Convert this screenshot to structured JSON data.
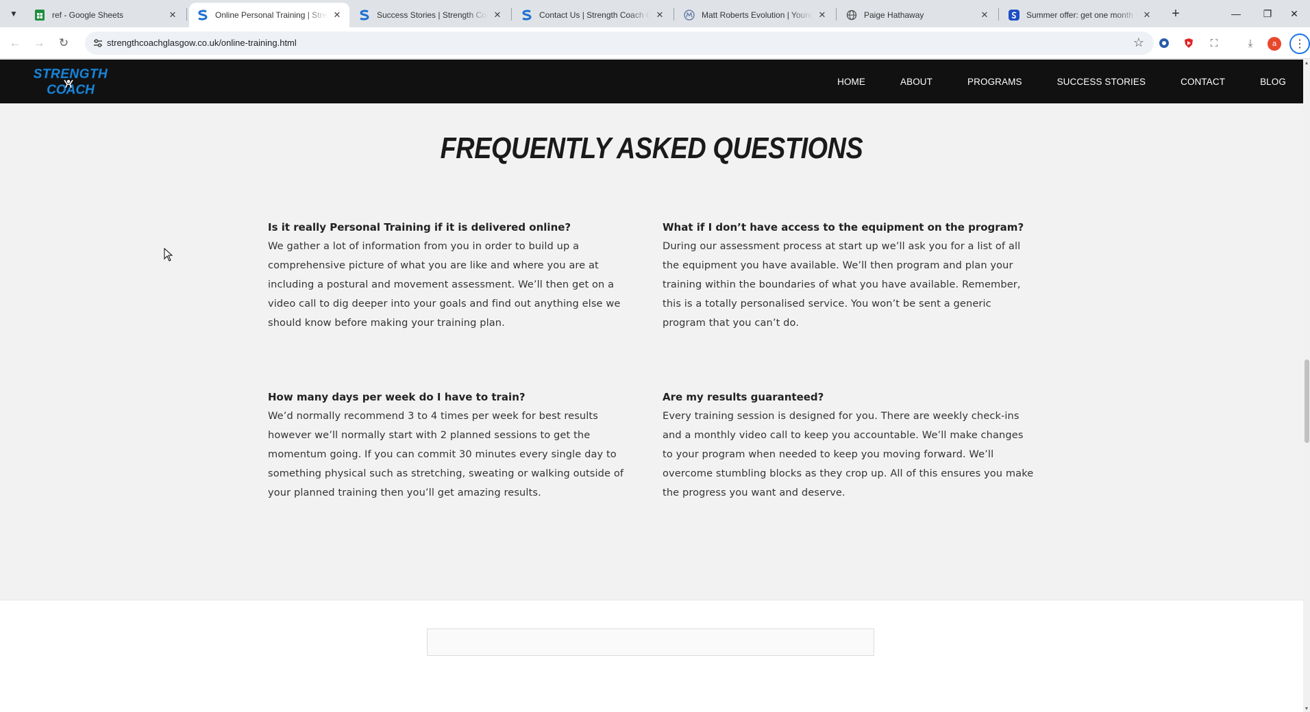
{
  "browser": {
    "tabs": [
      {
        "title": "ref - Google Sheets",
        "favicon": "sheets-icon",
        "active": false
      },
      {
        "title": "Online Personal Training | Strength Coach Glasgow",
        "favicon": "strength-coach-icon",
        "active": true
      },
      {
        "title": "Success Stories | Strength Coach Glasgow",
        "favicon": "strength-coach-icon",
        "active": false
      },
      {
        "title": "Contact Us | Strength Coach Glasgow",
        "favicon": "strength-coach-icon",
        "active": false
      },
      {
        "title": "Matt Roberts Evolution | Young",
        "favicon": "mr-icon",
        "active": false
      },
      {
        "title": "Paige Hathaway",
        "favicon": "globe-icon",
        "active": false
      },
      {
        "title": "Summer offer: get one month free",
        "favicon": "offer-icon",
        "active": false
      }
    ],
    "url": "strengthcoachglasgow.co.uk/online-training.html",
    "profile_initial": "a",
    "colors": {
      "tabstrip": "#dfe3e8",
      "accent": "#1a73e8"
    }
  },
  "site": {
    "logo": {
      "line1": "STRENGTH",
      "line2": "COACH",
      "color": "#1e88d8"
    },
    "nav": [
      "HOME",
      "ABOUT",
      "PROGRAMS",
      "SUCCESS STORIES",
      "CONTACT",
      "BLOG"
    ],
    "faq_title": "FREQUENTLY ASKED QUESTIONS",
    "faqs": [
      {
        "question": "Is it really Personal Training if it is delivered online?",
        "answer": "We gather a lot of information from you in order to build up a comprehensive picture of what you are like and where you are at including a postural and movement assessment. We’ll then get on a video call to dig deeper into your goals and find out anything else we should know before making your training plan."
      },
      {
        "question": "What if I don’t have access to the equipment on the program?",
        "answer": "During our assessment process at start up we’ll ask you for a list of all the equipment you have available. We’ll then program and plan your training within the boundaries of what you have available. Remember, this is a totally personalised service. You won’t be sent a generic program that you can’t do."
      },
      {
        "question": "How many days per week do I have to train?",
        "answer": "We’d normally recommend 3 to 4 times per week for best results however we’ll normally start with 2 planned sessions to get the momentum going. If you can commit 30 minutes every single day to something physical such as stretching, sweating or walking outside of your planned training then you’ll get amazing results."
      },
      {
        "question": "Are my results guaranteed?",
        "answer": "Every training session is designed for you. There are weekly check-ins and a monthly video call to keep you accountable. We’ll make changes to your program when needed to keep you moving forward. We’ll overcome stumbling blocks as they crop up. All of this ensures you make the progress you want and deserve."
      }
    ]
  }
}
